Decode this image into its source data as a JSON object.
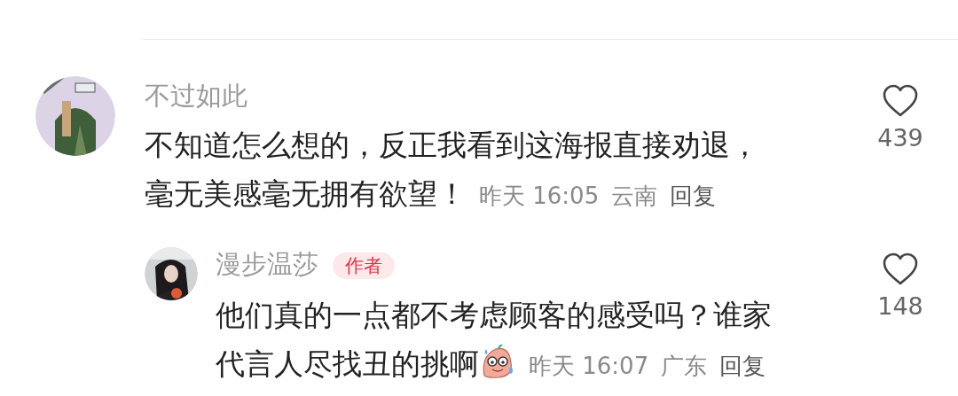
{
  "comments": [
    {
      "username": "不过如此",
      "text_lines": [
        "不知道怎么想的，反正我看到这海报直接劝退，",
        "毫无美感毫无拥有欲望！"
      ],
      "time": "昨天 16:05",
      "location": "云南",
      "reply_label": "回复",
      "likes": "439",
      "replies": [
        {
          "username": "漫步温莎",
          "badge": "作者",
          "text_lines": [
            "他们真的一点都不考虑顾客的感受吗？谁家",
            "代言人尽找丑的挑啊"
          ],
          "emoji": true,
          "time": "昨天 16:07",
          "location": "广东",
          "reply_label": "回复",
          "likes": "148"
        }
      ]
    }
  ]
}
